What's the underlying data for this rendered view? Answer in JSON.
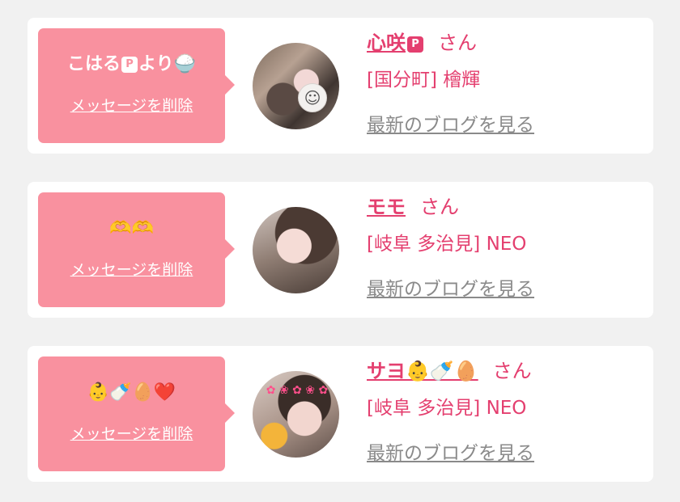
{
  "messages": [
    {
      "message_text": "こはる",
      "message_badge": "P",
      "message_text_suffix": "より🍚",
      "delete_label": "メッセージを削除",
      "name": "心咲",
      "name_badge": "P",
      "honorific": "さん",
      "shop": "[国分町] 檜輝",
      "blog_label": "最新のブログを見る"
    },
    {
      "message_text": "🫶🫶",
      "delete_label": "メッセージを削除",
      "name": "モモ",
      "honorific": "さん",
      "shop": "[岐阜 多治見] NEO",
      "blog_label": "最新のブログを見る"
    },
    {
      "message_text": "👶🍼🥚❤️",
      "delete_label": "メッセージを削除",
      "name": "サヨ👶🍼🥚",
      "honorific": "さん",
      "shop": "[岐阜 多治見] NEO",
      "blog_label": "最新のブログを見る"
    }
  ],
  "colors": {
    "accent": "#e43f6f",
    "bubble": "#f9919f",
    "background": "#f1f1f1",
    "link_gray": "#8a8a8a"
  }
}
